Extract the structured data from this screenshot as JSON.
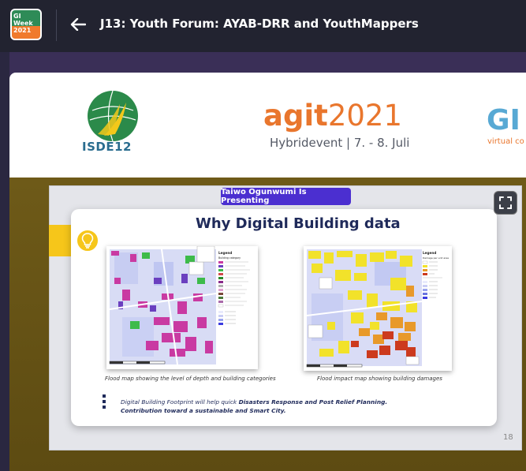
{
  "app": {
    "logo_lines": [
      "GI",
      "Week",
      "2021"
    ],
    "title": "J13: Youth Forum: AYAB-DRR and YouthMappers"
  },
  "banner": {
    "isde_label": "ISDE12",
    "agit_word": "agit",
    "agit_year": "2021",
    "agit_sub": "Hybridevent | 7. - 8. Juli",
    "gi_label": "GI",
    "gi_sub": "virtual co"
  },
  "presenter": {
    "label": "Taiwo Ogunwumi Is Presenting"
  },
  "slide": {
    "title": "Why Digital Building data",
    "caption_left": "Flood map showing the level of depth and building categories",
    "caption_right": "Flood impact map showing building damages",
    "body_line1_prefix": "Digital Building Footprint will help quick ",
    "body_line1_bold": "Disasters Response and Post Relief Planning.",
    "body_line2": "Contribution toward a sustainable and Smart City.",
    "page_number": "18",
    "map_left_legend_title": "Legend",
    "map_left_legend_sub": "Building category",
    "map_right_legend_title": "Legend",
    "map_right_legend_sub": "Damage per unit area"
  },
  "icons": {
    "back": "back-arrow-icon",
    "fullscreen": "fullscreen-icon",
    "bulb": "lightbulb-icon"
  },
  "colors": {
    "topbar": "#222330",
    "presenter_badge": "#4b2fd0",
    "slide_title": "#1f2a5a",
    "highlight_yellow": "#f6c61a",
    "agit_orange": "#e9762d"
  }
}
